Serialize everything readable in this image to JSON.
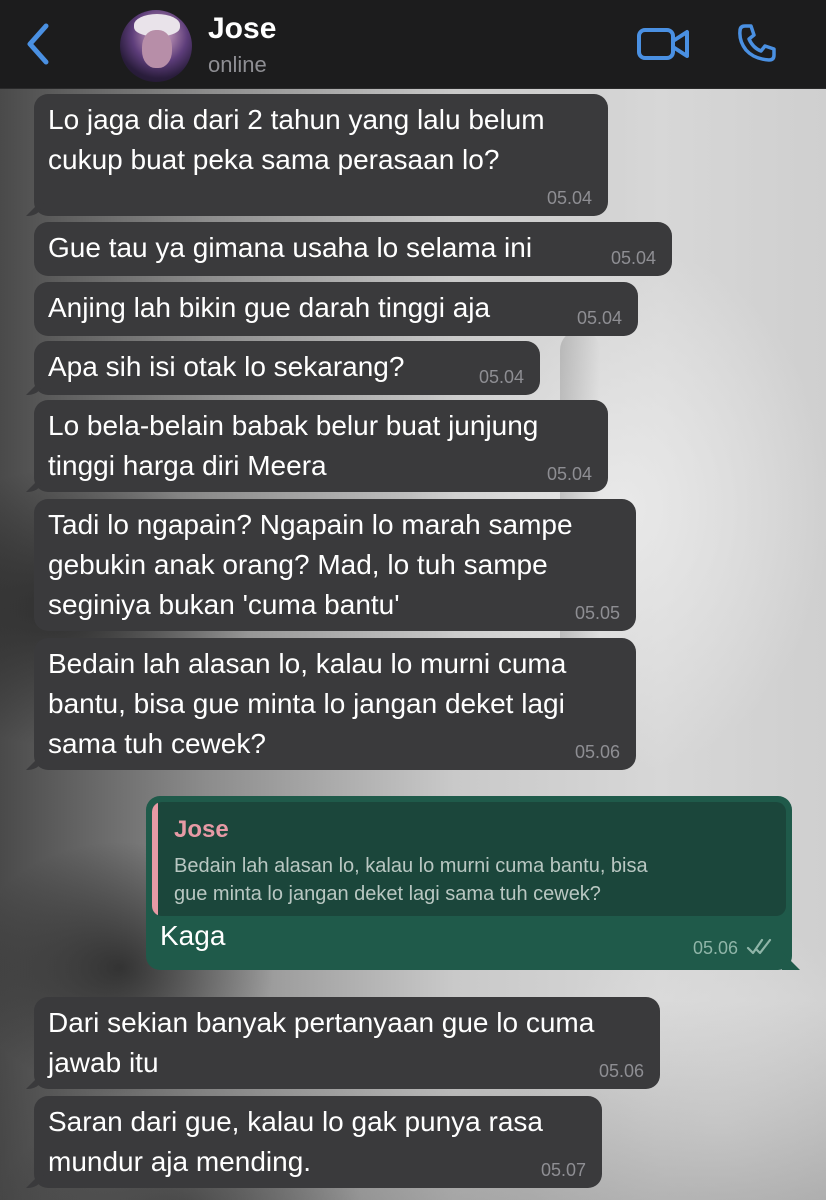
{
  "header": {
    "contact_name": "Jose",
    "status": "online"
  },
  "messages": [
    {
      "text": "Lo jaga dia dari 2 tahun yang lalu belum\ncukup buat peka sama perasaan lo?",
      "time": "05.04"
    },
    {
      "text": "Gue tau ya gimana usaha lo selama ini",
      "time": "05.04"
    },
    {
      "text": "Anjing lah bikin gue darah tinggi aja",
      "time": "05.04"
    },
    {
      "text": "Apa sih isi otak lo sekarang?",
      "time": "05.04"
    },
    {
      "text": "Lo bela-belain babak belur buat junjung\ntinggi harga diri Meera",
      "time": "05.04"
    },
    {
      "text": "Tadi lo ngapain? Ngapain lo marah sampe\ngebukin anak orang? Mad, lo tuh sampe\nseginiya bukan 'cuma bantu'",
      "time": "05.05"
    },
    {
      "text": "Bedain lah alasan lo, kalau lo murni cuma\nbantu, bisa gue minta lo jangan deket lagi\nsama tuh cewek?",
      "time": "05.06"
    },
    {
      "text": "Dari sekian banyak pertanyaan gue lo cuma\njawab itu",
      "time": "05.06"
    },
    {
      "text": "Saran dari gue, kalau lo gak punya rasa\nmundur aja mending.",
      "time": "05.07"
    }
  ],
  "reply": {
    "quoted_name": "Jose",
    "quoted_text": "Bedain lah alasan lo, kalau lo murni cuma bantu, bisa\ngue minta lo jangan deket lagi sama tuh cewek?",
    "text": "Kaga",
    "time": "05.06",
    "status_icon": "double-check-icon"
  },
  "colors": {
    "header_bg": "#1c1c1d",
    "incoming_bubble": "#3a3a3c",
    "outgoing_bubble": "#1f5a4a",
    "accent_blue": "#4a90e2",
    "quote_accent": "#e79aa5"
  }
}
